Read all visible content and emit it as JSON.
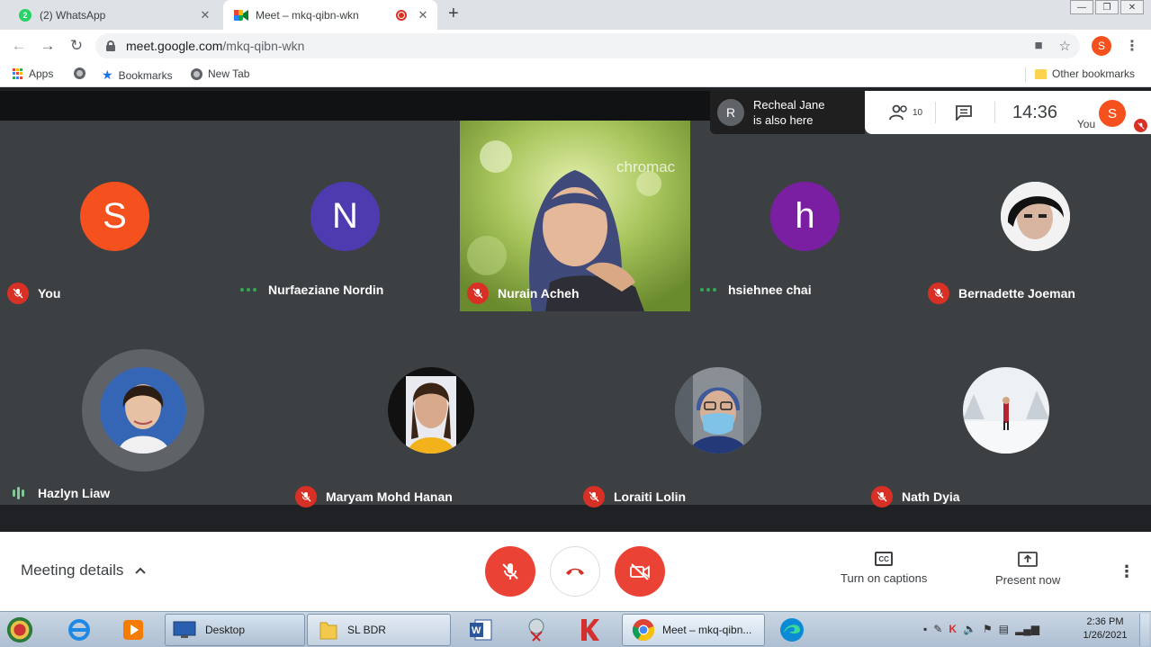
{
  "browser": {
    "tabs": [
      {
        "title": "(2) WhatsApp",
        "badge": "2",
        "active": false
      },
      {
        "title": "Meet – mkq-qibn-wkn",
        "active": true
      }
    ],
    "url_host": "meet.google.com",
    "url_path": "/mkq-qibn-wkn",
    "profile_initial": "S",
    "bookmarks": [
      "Apps",
      "Bookmarks",
      "New Tab"
    ],
    "other_bookmarks": "Other bookmarks"
  },
  "meet": {
    "notification": {
      "initial": "R",
      "line1": "Recheal Jane",
      "line2": "is also here"
    },
    "participants_count": "10",
    "time": "14:36",
    "self_label": "You",
    "self_initial": "S",
    "participants": [
      {
        "name": "You",
        "initial": "S",
        "color": "#f4511e",
        "status": "muted"
      },
      {
        "name": "Nurfaeziane Nordin",
        "initial": "N",
        "color": "#4f3bb0",
        "status": "connecting"
      },
      {
        "name": "Nurain Acheh",
        "status": "muted",
        "video": true,
        "watermark": "chromac"
      },
      {
        "name": "hsiehnee chai",
        "initial": "h",
        "color": "#7b1fa2",
        "status": "connecting"
      },
      {
        "name": "Bernadette Joeman",
        "status": "muted"
      },
      {
        "name": "Hazlyn Liaw",
        "status": "speaking"
      },
      {
        "name": "Maryam Mohd Hanan",
        "status": "muted"
      },
      {
        "name": "Loraiti Lolin",
        "status": "muted"
      },
      {
        "name": "Nath Dyia",
        "status": "muted"
      }
    ],
    "bottom": {
      "meeting_details": "Meeting details",
      "captions_label": "Turn on captions",
      "captions_icon_text": "CC",
      "present_label": "Present now"
    }
  },
  "taskbar": {
    "buttons": [
      "Desktop",
      "SL BDR",
      "Meet – mkq-qibn..."
    ],
    "time": "2:36 PM",
    "date": "1/26/2021"
  }
}
